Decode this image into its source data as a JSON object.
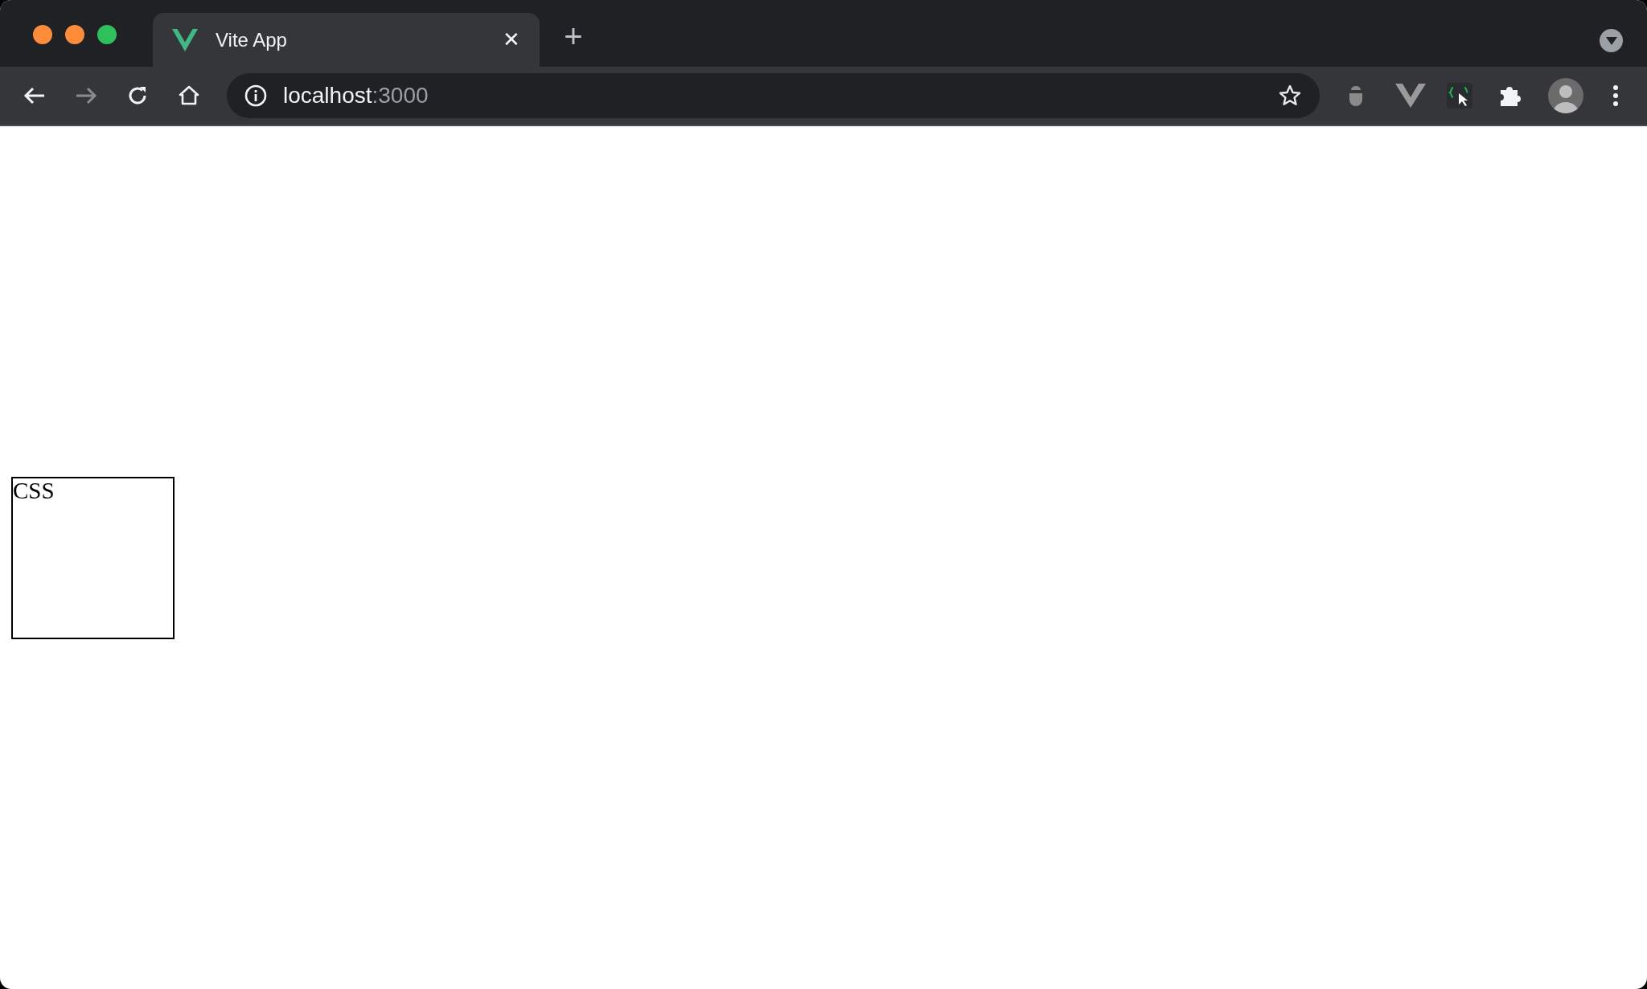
{
  "window": {
    "controls": [
      {
        "kind": "close"
      },
      {
        "kind": "minimize"
      },
      {
        "kind": "maximize"
      }
    ]
  },
  "tabs": [
    {
      "title": "Vite App",
      "selected": true,
      "close": "✕"
    }
  ],
  "new_tab": "+",
  "toolbar": {
    "back": {
      "disabled": false
    },
    "forward": {
      "disabled": true
    }
  },
  "address_bar": {
    "host": "localhost",
    "port": ":3000"
  },
  "page": {
    "box": {
      "text": "CSS"
    }
  }
}
